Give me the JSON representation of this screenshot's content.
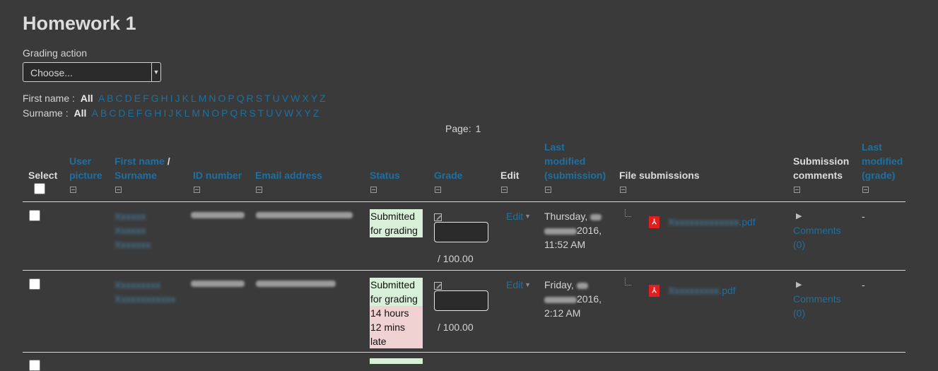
{
  "page": {
    "title": "Homework 1"
  },
  "grading_action": {
    "label": "Grading action",
    "selected": "Choose..."
  },
  "first_name_filter": {
    "label": "First name :",
    "all": "All",
    "letters": [
      "A",
      "B",
      "C",
      "D",
      "E",
      "F",
      "G",
      "H",
      "I",
      "J",
      "K",
      "L",
      "M",
      "N",
      "O",
      "P",
      "Q",
      "R",
      "S",
      "T",
      "U",
      "V",
      "W",
      "X",
      "Y",
      "Z"
    ]
  },
  "surname_filter": {
    "label": "Surname :",
    "all": "All",
    "letters": [
      "A",
      "B",
      "C",
      "D",
      "E",
      "F",
      "G",
      "H",
      "I",
      "J",
      "K",
      "L",
      "M",
      "N",
      "O",
      "P",
      "Q",
      "R",
      "S",
      "T",
      "U",
      "V",
      "W",
      "X",
      "Y",
      "Z"
    ]
  },
  "pager": {
    "label": "Page:",
    "current": "1"
  },
  "columns": {
    "select": "Select",
    "user_picture_1": "User",
    "user_picture_2": "picture",
    "first_name": "First name",
    "slash": " /",
    "surname": "Surname",
    "id_number": "ID number",
    "email": "Email address",
    "status": "Status",
    "grade": "Grade",
    "edit": "Edit",
    "last_mod_sub_1": "Last",
    "last_mod_sub_2": "modified",
    "last_mod_sub_3": "(submission)",
    "file_submissions": "File submissions",
    "sub_comments_1": "Submission",
    "sub_comments_2": "comments",
    "last_mod_grade_1": "Last",
    "last_mod_grade_2": "modified",
    "last_mod_grade_3": "(grade)"
  },
  "rows": [
    {
      "name_1": "Xxxxxx",
      "name_2": "Xxxxxx",
      "name_3": "Xxxxxxx",
      "status_1": "Submitted",
      "status_2": "for grading",
      "grade_out_of": "/ 100.00",
      "edit": "Edit",
      "modified_1": "Thursday,",
      "modified_2": "2016,",
      "modified_3": "11:52 AM",
      "file_name_blurred": "Xxxxxxxxxxxxxx",
      "file_ext": ".pdf",
      "comments_1": "Comments",
      "comments_2": "(0)",
      "last_grade": "-"
    },
    {
      "name_1": "Xxxxxxxxx",
      "name_2": "Xxxxxxxxxxxx",
      "status_1": "Submitted",
      "status_2": "for grading",
      "status_3": "14 hours",
      "status_4": "12 mins",
      "status_5": "late",
      "grade_out_of": "/ 100.00",
      "edit": "Edit",
      "modified_1": "Friday,",
      "modified_2": "2016,",
      "modified_3": "2:12 AM",
      "file_name_blurred": "Xxxxxxxxxx",
      "file_ext": ".pdf",
      "comments_1": "Comments",
      "comments_2": "(0)",
      "last_grade": "-"
    }
  ],
  "colors": {
    "background": "#3a3a3a",
    "link": "#1f6f9f",
    "status_ok": "#d8f0d8",
    "status_late": "#f0d2d2",
    "pdf_icon": "#e02020"
  }
}
